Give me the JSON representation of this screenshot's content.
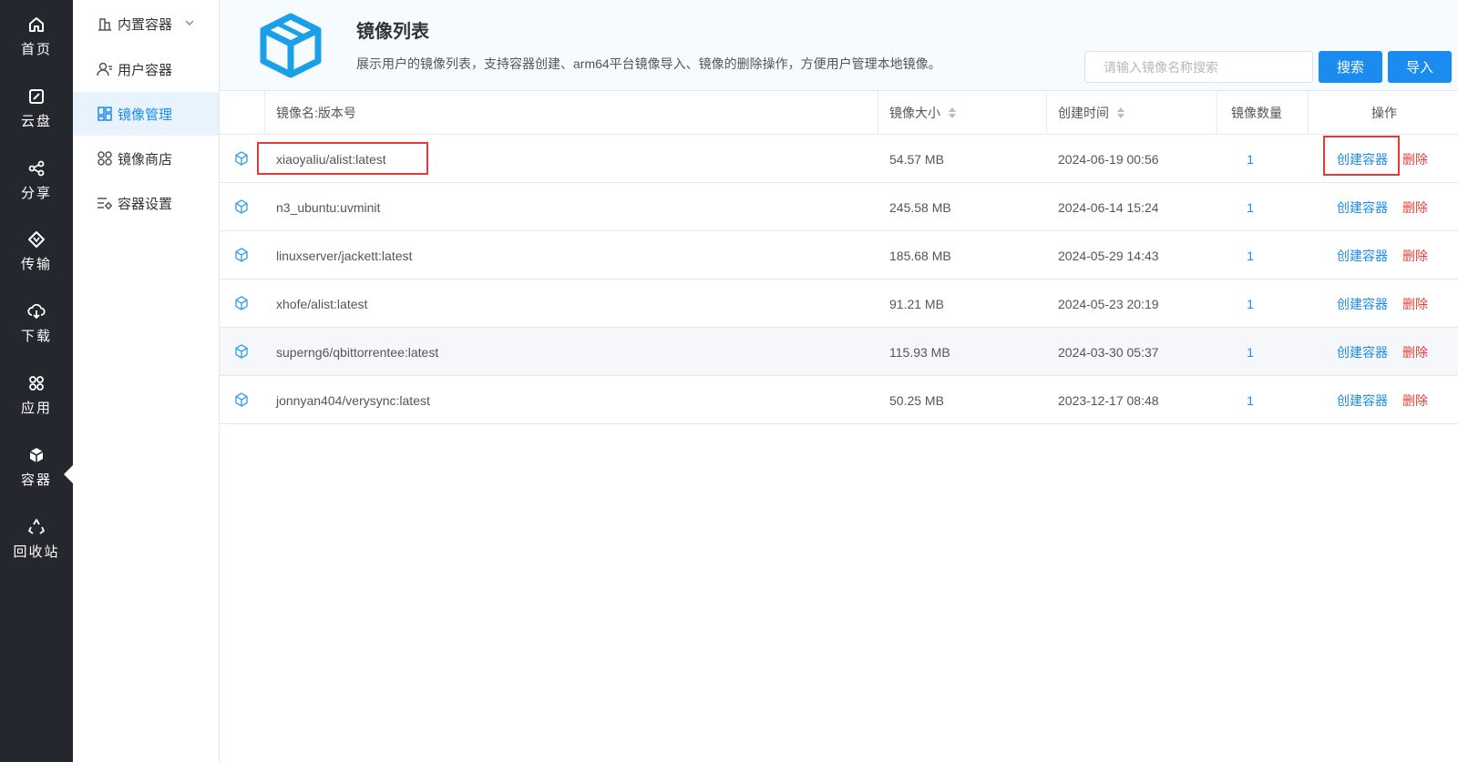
{
  "rail": {
    "items": [
      {
        "label": "首页",
        "icon": "home-icon"
      },
      {
        "label": "云盘",
        "icon": "disk-icon"
      },
      {
        "label": "分享",
        "icon": "share-icon"
      },
      {
        "label": "传输",
        "icon": "transfer-icon"
      },
      {
        "label": "下载",
        "icon": "download-icon"
      },
      {
        "label": "应用",
        "icon": "apps-icon"
      },
      {
        "label": "容器",
        "icon": "container-icon"
      },
      {
        "label": "回收站",
        "icon": "recycle-icon"
      }
    ],
    "active": "容器"
  },
  "subnav": {
    "items": [
      {
        "label": "内置容器",
        "icon": "builtin-icon"
      },
      {
        "label": "用户容器",
        "icon": "user-icon"
      },
      {
        "label": "镜像管理",
        "icon": "grid-icon"
      },
      {
        "label": "镜像商店",
        "icon": "store-icon"
      },
      {
        "label": "容器设置",
        "icon": "settings-icon"
      }
    ],
    "active": "镜像管理"
  },
  "header": {
    "title": "镜像列表",
    "description": "展示用户的镜像列表，支持容器创建、arm64平台镜像导入、镜像的删除操作，方便用户管理本地镜像。",
    "search_placeholder": "请输入镜像名称搜索",
    "search_label": "搜索",
    "import_label": "导入"
  },
  "table": {
    "columns": {
      "name": "镜像名:版本号",
      "size": "镜像大小",
      "time": "创建时间",
      "count": "镜像数量",
      "actions": "操作"
    },
    "rows": [
      {
        "name": "xiaoyaliu/alist:latest",
        "size": "54.57 MB",
        "time": "2024-06-19 00:56",
        "count": "1",
        "create": "创建容器",
        "delete": "删除"
      },
      {
        "name": "n3_ubuntu:uvminit",
        "size": "245.58 MB",
        "time": "2024-06-14 15:24",
        "count": "1",
        "create": "创建容器",
        "delete": "删除"
      },
      {
        "name": "linuxserver/jackett:latest",
        "size": "185.68 MB",
        "time": "2024-05-29 14:43",
        "count": "1",
        "create": "创建容器",
        "delete": "删除"
      },
      {
        "name": "xhofe/alist:latest",
        "size": "91.21 MB",
        "time": "2024-05-23 20:19",
        "count": "1",
        "create": "创建容器",
        "delete": "删除"
      },
      {
        "name": "superng6/qbittorrentee:latest",
        "size": "115.93 MB",
        "time": "2024-03-30 05:37",
        "count": "1",
        "create": "创建容器",
        "delete": "删除"
      },
      {
        "name": "jonnyan404/verysync:latest",
        "size": "50.25 MB",
        "time": "2023-12-17 08:48",
        "count": "1",
        "create": "创建容器",
        "delete": "删除"
      }
    ],
    "highlighted_row": 4
  },
  "colors": {
    "rail_bg": "#24272e",
    "accent": "#1a8cf0",
    "danger": "#e8413b",
    "annotation": "#e53935"
  }
}
